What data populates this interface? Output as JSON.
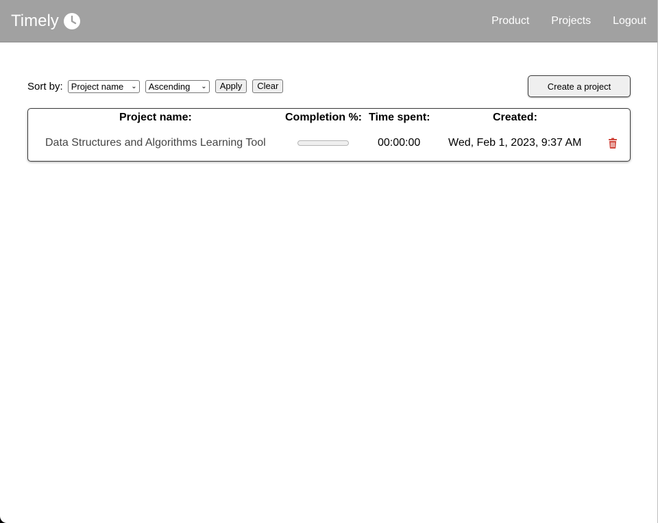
{
  "app": {
    "brand": "Timely",
    "brand_icon": "clock-icon"
  },
  "nav": {
    "items": [
      "Product",
      "Projects",
      "Logout"
    ]
  },
  "toolbar": {
    "sort_label": "Sort by:",
    "sort_field": "Project name",
    "sort_order": "Ascending",
    "apply_label": "Apply",
    "clear_label": "Clear",
    "create_label": "Create a project"
  },
  "table": {
    "headers": [
      "Project name:",
      "Completion %:",
      "Time spent:",
      "Created:"
    ],
    "rows": [
      {
        "name": "Data Structures and Algorithms Learning Tool",
        "completion": 0,
        "time_spent": "00:00:00",
        "created": "Wed, Feb 1, 2023, 9:37 AM",
        "delete_icon": "trash-icon"
      }
    ]
  },
  "colors": {
    "navbar": "#a1a1a1",
    "delete_icon": "#d0463c"
  }
}
